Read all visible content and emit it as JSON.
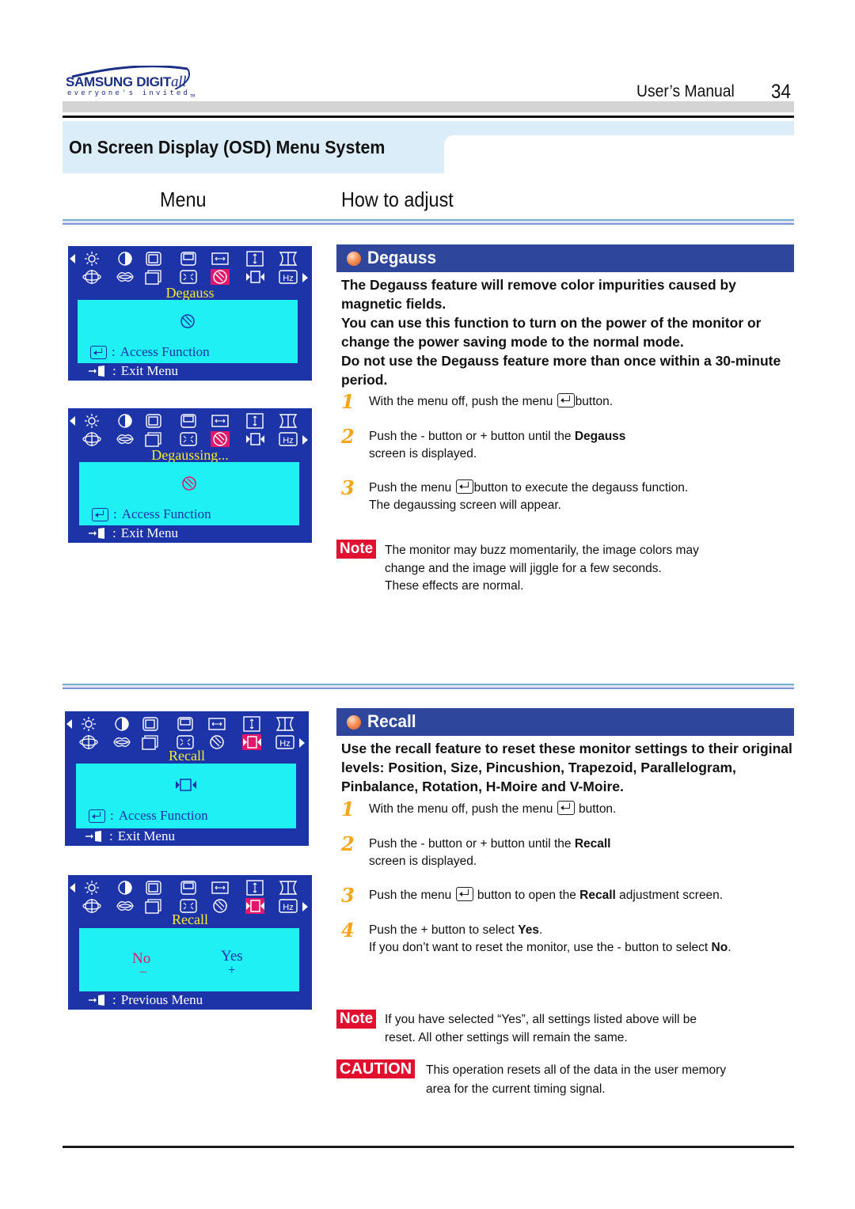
{
  "header": {
    "brand": "SAMSUNG DIGIT",
    "brand_suffix": "all",
    "tagline": "everyone's invited",
    "tagline_tm": "TM",
    "manual_label": "User’s  Manual",
    "page_number": "34"
  },
  "section": {
    "title": "On Screen Display (OSD) Menu System",
    "col_menu": "Menu",
    "col_adjust": "How to adjust"
  },
  "osd": {
    "icons_row1": [
      "brightness-icon",
      "contrast-icon",
      "h-position-icon",
      "v-position-icon",
      "h-size-icon",
      "v-size-icon",
      "pincushion-icon"
    ],
    "icons_row2": [
      "rotation-icon",
      "moire-icon",
      "language-icon",
      "size-icon",
      "degauss-icon",
      "recall-icon",
      "frequency-icon"
    ],
    "hz_label": "Hz",
    "access_function": "Access Function",
    "exit_menu": "Exit Menu",
    "previous_menu": "Previous Menu",
    "colon": ":",
    "colors": {
      "background": "#1d33a8",
      "panel": "#1ff0f4",
      "highlight": "#e3176a",
      "caption": "#f5ee2a"
    },
    "screens": [
      {
        "caption": "Degauss",
        "active_icon": "degauss-icon"
      },
      {
        "caption": "Degaussing...",
        "active_icon": "degauss-icon"
      },
      {
        "caption": "Recall",
        "active_icon": "recall-icon"
      },
      {
        "caption": "Recall",
        "active_icon": "recall-icon",
        "no_label": "No",
        "no_sign": "−",
        "yes_label": "Yes",
        "yes_sign": "+"
      }
    ]
  },
  "degauss": {
    "title": "Degauss",
    "intro": [
      "The Degauss feature will remove color impurities caused by magnetic fields.",
      "You can use this function to turn on the power of the monitor or change the power saving mode to the normal mode.",
      "Do not use the Degauss feature more than once within a 30-minute period."
    ],
    "steps": [
      {
        "num": "1",
        "line1_a": "With the menu off, push the menu ",
        "line1_b": "button."
      },
      {
        "num": "2",
        "line1_a": "Push the - button or  + button until the ",
        "line1_bold": "Degauss",
        "line2": "screen is displayed."
      },
      {
        "num": "3",
        "line1_a": "Push the menu ",
        "line1_b": "button to execute the degauss function.",
        "line2": "The degaussing screen will appear."
      }
    ],
    "note_label": "Note",
    "note_lines": [
      "The monitor may buzz momentarily, the image colors may",
      "change and the image will jiggle for a few seconds.",
      "These effects are normal."
    ]
  },
  "recall": {
    "title": "Recall",
    "intro": [
      "Use the recall feature to reset these monitor settings to their original levels: Position, Size, Pincushion, Trapezoid, Parallelogram, Pinbalance, Rotation, H-Moire and V-Moire."
    ],
    "steps": [
      {
        "num": "1",
        "line1_a": "With the menu off, push the menu ",
        "line1_b": " button."
      },
      {
        "num": "2",
        "line1_a": "Push the - button or  + button until the ",
        "line1_bold": "Recall",
        "line2": "screen is displayed."
      },
      {
        "num": "3",
        "line1_a": "Push the menu ",
        "line1_b": " button to open the ",
        "line1_bold": "Recall",
        "line1_c": " adjustment screen."
      },
      {
        "num": "4",
        "line1_a": "Push the + button to select ",
        "line1_bold": "Yes",
        "line1_c": ".",
        "line2_a": "If you don’t want to reset the monitor, use the - button to select ",
        "line2_bold": "No",
        "line2_c": "."
      }
    ],
    "note_label": "Note",
    "note_lines": [
      "If you have selected “Yes”, all settings listed above will be",
      "reset. All other settings will remain the same."
    ],
    "caution_label": "CAUTION",
    "caution_lines": [
      "This operation resets all of the data in the user memory",
      "area for the current timing signal."
    ]
  },
  "colors": {
    "feature_bar": "#2e469c",
    "step_number": "#f5a516",
    "badge": "#e0102e",
    "title_band": "#dcedfa"
  }
}
